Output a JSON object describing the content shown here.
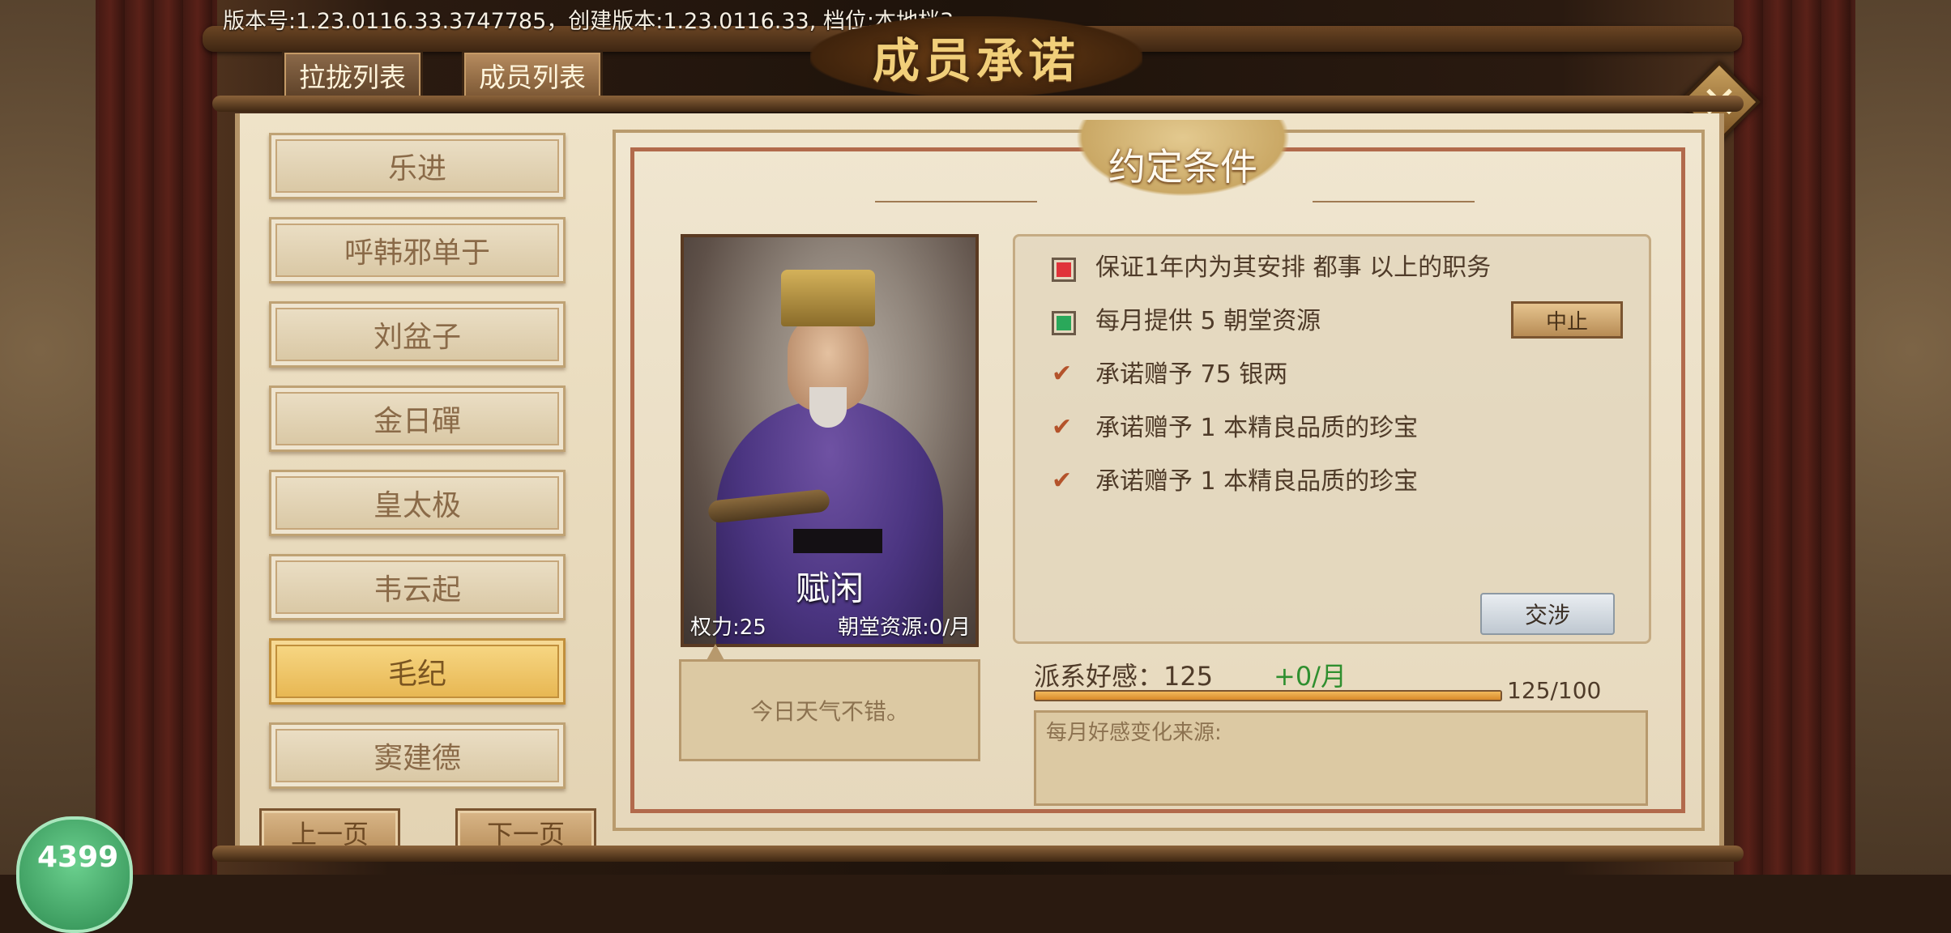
{
  "header": {
    "version_text": "版本号:1.23.0116.33.3747785，创建版本:1.23.0116.33, 档位:本地档3",
    "title": "成员承诺",
    "tabs": [
      {
        "label": "拉拢列表",
        "active": false
      },
      {
        "label": "成员列表",
        "active": true
      }
    ]
  },
  "member_list": {
    "items": [
      {
        "label": "乐进",
        "selected": false
      },
      {
        "label": "呼韩邪单于",
        "selected": false
      },
      {
        "label": "刘盆子",
        "selected": false
      },
      {
        "label": "金日磾",
        "selected": false
      },
      {
        "label": "皇太极",
        "selected": false
      },
      {
        "label": "韦云起",
        "selected": false
      },
      {
        "label": "毛纪",
        "selected": true
      },
      {
        "label": "窦建德",
        "selected": false
      }
    ],
    "prev_page": "上一页",
    "next_page": "下一页"
  },
  "agreement": {
    "section_title": "约定条件",
    "portrait": {
      "status_name": "赋闲",
      "power": "权力:25",
      "resource": "朝堂资源:0/月"
    },
    "speech": "今日天气不错。",
    "conditions": [
      {
        "icon": "red-square",
        "text": "保证1年内为其安排 都事 以上的职务"
      },
      {
        "icon": "green-square",
        "text": "每月提供 5 朝堂资源"
      },
      {
        "icon": "check",
        "text": "承诺赠予 75 银两"
      },
      {
        "icon": "check",
        "text": "承诺赠予 1 本精良品质的珍宝"
      },
      {
        "icon": "check",
        "text": "承诺赠予 1 本精良品质的珍宝"
      }
    ],
    "stop_label": "中止",
    "negotiate_label": "交涉",
    "favor": {
      "label": "派系好感：125",
      "rate": "+0/月",
      "progress": 1.0,
      "max_text": "125/100"
    },
    "source_label": "每月好感变化来源:"
  },
  "colors": {
    "red_square": "#e0343a",
    "green_square": "#2aa85a",
    "favor_rate": "#2f8f2f",
    "selected_item": "#e6b44e"
  },
  "badge": {
    "text": "4399"
  }
}
